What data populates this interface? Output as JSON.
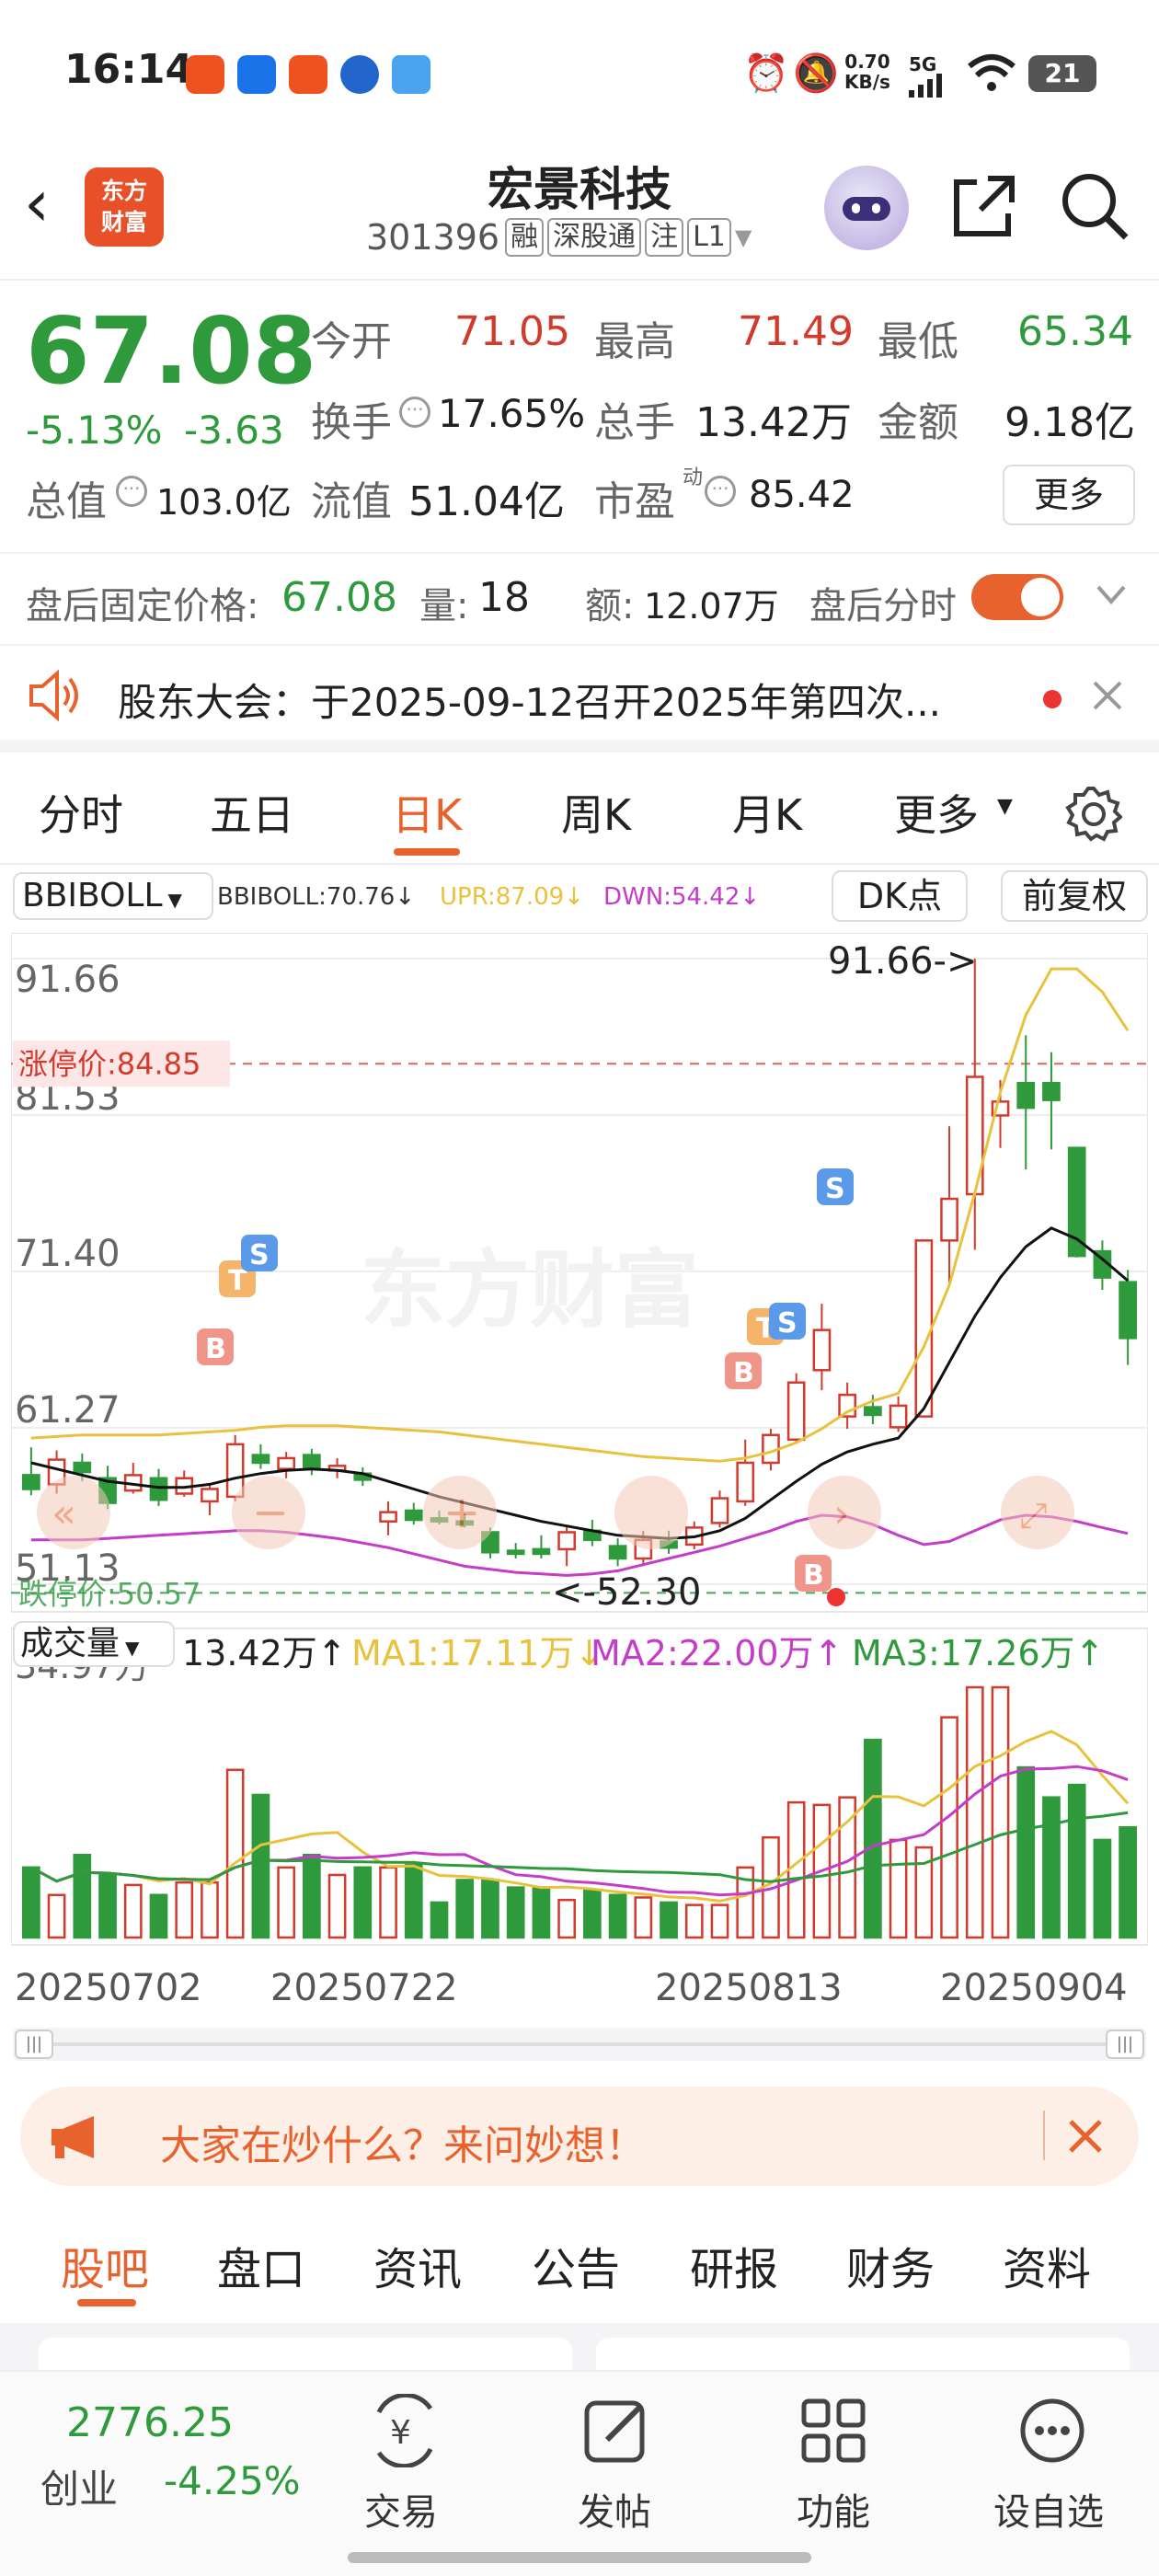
{
  "status": {
    "time": "16:14",
    "net_speed_value": "0.70",
    "net_speed_unit": "KB/s",
    "signal": "5G",
    "battery": "21"
  },
  "header": {
    "title": "宏景科技",
    "code": "301396",
    "tags": [
      "融",
      "深股通",
      "注",
      "L1"
    ]
  },
  "quote": {
    "price": "67.08",
    "change_pct": "-5.13%",
    "change": "-3.63",
    "open_label": "今开",
    "open": "71.05",
    "high_label": "最高",
    "high": "71.49",
    "low_label": "最低",
    "low": "65.34",
    "turnover_label": "换手",
    "turnover": "17.65%",
    "volume_label": "总手",
    "volume": "13.42万",
    "amount_label": "金额",
    "amount": "9.18亿",
    "mktcap_label": "总值",
    "mktcap": "103.0亿",
    "float_label": "流值",
    "float_cap": "51.04亿",
    "pe_label": "市盈",
    "pe_sup": "动",
    "pe": "85.42",
    "more": "更多"
  },
  "after_hours": {
    "price_label": "盘后固定价格:",
    "price": "67.08",
    "vol_label": "量:",
    "vol": "18",
    "amt_label": "额:",
    "amt": "12.07万",
    "toggle_label": "盘后分时",
    "toggle_on": true
  },
  "notice": {
    "text": "股东大会：于2025-09-12召开2025年第四次..."
  },
  "ktabs": {
    "items": [
      "分时",
      "五日",
      "日K",
      "周K",
      "月K",
      "更多"
    ],
    "active": 2
  },
  "chart_controls": {
    "indicator": "BBIBOLL",
    "bbiboll": "BBIBOLL:70.76",
    "upr": "UPR:87.09",
    "dwn": "DWN:54.42",
    "dk": "DK点",
    "fq": "前复权"
  },
  "price_axis": [
    "91.66",
    "81.53",
    "71.40",
    "61.27",
    "51.13"
  ],
  "annotations": {
    "limit_up": "涨停价:84.85",
    "limit_down": "跌停价:50.57",
    "high_mark": "91.66->",
    "low_mark": "<-52.30",
    "watermark": "东方财富"
  },
  "volume_controls": {
    "label": "成交量",
    "vol": "13.42万",
    "ma1": "MA1:17.11万",
    "ma2": "MA2:22.00万",
    "ma3": "MA3:17.26万",
    "axis_top": "34.97万"
  },
  "dates": [
    "20250702",
    "20250722",
    "20250813",
    "20250904"
  ],
  "ask": {
    "text": "大家在炒什么？来问妙想！"
  },
  "btabs": {
    "items": [
      "股吧",
      "盘口",
      "资讯",
      "公告",
      "研报",
      "财务",
      "资料"
    ],
    "active": 0
  },
  "bottom": {
    "index_value": "2776.25",
    "index_name": "创业",
    "index_change": "-4.25%",
    "items": [
      "交易",
      "发帖",
      "功能",
      "设自选"
    ]
  },
  "colors": {
    "up": "#d33a2c",
    "down": "#2e9a3c",
    "accent": "#e8622e",
    "ma_yellow": "#e8c23c",
    "ma_purple": "#c43cc8"
  },
  "chart_data": {
    "type": "candlestick",
    "ylim": [
      51.13,
      91.66
    ],
    "candles": [
      {
        "o": 58.2,
        "h": 60.0,
        "l": 56.9,
        "c": 57.3
      },
      {
        "o": 57.6,
        "h": 59.8,
        "l": 57.0,
        "c": 59.2
      },
      {
        "o": 59.0,
        "h": 59.6,
        "l": 57.8,
        "c": 58.4
      },
      {
        "o": 58.0,
        "h": 58.8,
        "l": 56.0,
        "c": 56.4
      },
      {
        "o": 57.2,
        "h": 59.0,
        "l": 57.0,
        "c": 58.2
      },
      {
        "o": 58.0,
        "h": 58.6,
        "l": 56.2,
        "c": 56.6
      },
      {
        "o": 57.0,
        "h": 58.5,
        "l": 56.8,
        "c": 58.0
      },
      {
        "o": 56.5,
        "h": 57.6,
        "l": 55.6,
        "c": 57.3
      },
      {
        "o": 56.8,
        "h": 60.8,
        "l": 56.5,
        "c": 60.2
      },
      {
        "o": 59.5,
        "h": 60.2,
        "l": 58.6,
        "c": 59.0
      },
      {
        "o": 58.6,
        "h": 59.7,
        "l": 58.0,
        "c": 59.3
      },
      {
        "o": 59.5,
        "h": 59.9,
        "l": 58.2,
        "c": 58.6
      },
      {
        "o": 58.5,
        "h": 59.3,
        "l": 58.0,
        "c": 58.8
      },
      {
        "o": 58.3,
        "h": 58.7,
        "l": 57.5,
        "c": 57.9
      },
      {
        "o": 55.2,
        "h": 56.5,
        "l": 54.3,
        "c": 55.8
      },
      {
        "o": 55.9,
        "h": 56.4,
        "l": 55.0,
        "c": 55.3
      },
      {
        "o": 55.4,
        "h": 55.9,
        "l": 55.0,
        "c": 55.2
      },
      {
        "o": 55.2,
        "h": 55.7,
        "l": 54.8,
        "c": 55.0
      },
      {
        "o": 54.5,
        "h": 54.8,
        "l": 52.8,
        "c": 53.2
      },
      {
        "o": 53.3,
        "h": 53.8,
        "l": 52.8,
        "c": 53.1
      },
      {
        "o": 53.4,
        "h": 54.3,
        "l": 52.8,
        "c": 53.1
      },
      {
        "o": 53.4,
        "h": 54.9,
        "l": 52.3,
        "c": 54.5
      },
      {
        "o": 54.6,
        "h": 55.3,
        "l": 53.6,
        "c": 54.0
      },
      {
        "o": 53.6,
        "h": 54.1,
        "l": 52.3,
        "c": 52.8
      },
      {
        "o": 52.8,
        "h": 54.6,
        "l": 52.3,
        "c": 54.0
      },
      {
        "o": 53.9,
        "h": 54.6,
        "l": 53.1,
        "c": 53.5
      },
      {
        "o": 53.7,
        "h": 55.2,
        "l": 53.4,
        "c": 54.8
      },
      {
        "o": 55.1,
        "h": 57.2,
        "l": 54.8,
        "c": 56.7
      },
      {
        "o": 56.5,
        "h": 60.5,
        "l": 56.2,
        "c": 59.0
      },
      {
        "o": 59.0,
        "h": 61.2,
        "l": 58.5,
        "c": 60.8
      },
      {
        "o": 60.5,
        "h": 64.8,
        "l": 60.3,
        "c": 64.2
      },
      {
        "o": 65.0,
        "h": 69.3,
        "l": 63.7,
        "c": 67.6
      },
      {
        "o": 62.0,
        "h": 64.2,
        "l": 61.2,
        "c": 63.4
      },
      {
        "o": 62.6,
        "h": 63.4,
        "l": 61.5,
        "c": 62.1
      },
      {
        "o": 61.3,
        "h": 63.3,
        "l": 61.0,
        "c": 62.7
      },
      {
        "o": 62.0,
        "h": 73.4,
        "l": 62.0,
        "c": 73.4
      },
      {
        "o": 73.4,
        "h": 80.8,
        "l": 70.6,
        "c": 76.1
      },
      {
        "o": 76.4,
        "h": 91.66,
        "l": 72.8,
        "c": 84.0
      },
      {
        "o": 81.5,
        "h": 83.8,
        "l": 79.4,
        "c": 82.4
      },
      {
        "o": 83.6,
        "h": 86.7,
        "l": 78.0,
        "c": 82.0
      },
      {
        "o": 83.6,
        "h": 85.6,
        "l": 79.3,
        "c": 82.5
      },
      {
        "o": 79.4,
        "h": 79.4,
        "l": 72.3,
        "c": 72.4
      },
      {
        "o": 72.7,
        "h": 73.4,
        "l": 70.2,
        "c": 71.0
      },
      {
        "o": 70.7,
        "h": 71.49,
        "l": 65.34,
        "c": 67.08
      }
    ],
    "volumes": [
      0.28,
      0.17,
      0.33,
      0.25,
      0.21,
      0.17,
      0.22,
      0.22,
      0.67,
      0.57,
      0.28,
      0.33,
      0.25,
      0.28,
      0.28,
      0.29,
      0.14,
      0.23,
      0.23,
      0.2,
      0.2,
      0.15,
      0.19,
      0.17,
      0.16,
      0.14,
      0.13,
      0.13,
      0.28,
      0.4,
      0.54,
      0.53,
      0.56,
      0.79,
      0.39,
      0.36,
      0.88,
      1.0,
      1.0,
      0.68,
      0.56,
      0.61,
      0.39,
      0.44
    ],
    "boll_upper": [
      60.6,
      60.7,
      60.8,
      60.8,
      60.8,
      60.8,
      60.9,
      61.0,
      61.1,
      61.3,
      61.4,
      61.4,
      61.4,
      61.3,
      61.2,
      61.1,
      61.0,
      60.8,
      60.6,
      60.4,
      60.2,
      60.0,
      59.8,
      59.6,
      59.4,
      59.3,
      59.2,
      59.1,
      59.3,
      59.7,
      60.3,
      61.2,
      62.3,
      63.0,
      63.5,
      66.5,
      70.5,
      76.5,
      83.0,
      88.0,
      91.0,
      91.0,
      89.5,
      87.0
    ],
    "bbi": [
      59.0,
      58.6,
      58.2,
      57.8,
      57.6,
      57.4,
      57.4,
      57.6,
      58.0,
      58.3,
      58.5,
      58.6,
      58.5,
      58.3,
      57.8,
      57.3,
      56.8,
      56.4,
      56.0,
      55.6,
      55.2,
      54.9,
      54.6,
      54.3,
      54.2,
      54.1,
      54.2,
      54.6,
      55.4,
      56.6,
      57.8,
      58.9,
      59.7,
      60.2,
      60.6,
      62.5,
      65.5,
      68.5,
      71.0,
      73.0,
      74.2,
      73.5,
      72.2,
      70.8
    ],
    "boll_lower": [
      54.0,
      54.0,
      54.0,
      54.1,
      54.2,
      54.3,
      54.4,
      54.5,
      54.6,
      54.6,
      54.5,
      54.3,
      54.1,
      53.8,
      53.5,
      53.1,
      52.7,
      52.3,
      52.1,
      51.9,
      51.8,
      51.7,
      51.8,
      52.0,
      52.4,
      52.8,
      53.2,
      53.6,
      54.1,
      54.6,
      55.2,
      55.6,
      55.5,
      55.0,
      54.3,
      53.7,
      53.9,
      54.6,
      55.3,
      55.6,
      55.5,
      55.2,
      54.8,
      54.42
    ]
  }
}
